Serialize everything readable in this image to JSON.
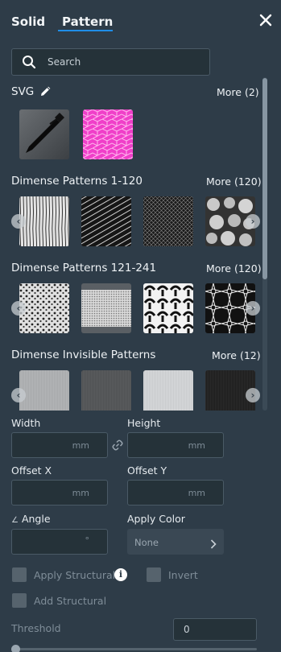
{
  "tabs": [
    {
      "label": "Solid",
      "active": false
    },
    {
      "label": "Pattern",
      "active": true
    }
  ],
  "search": {
    "placeholder": "Search",
    "value": ""
  },
  "sections": [
    {
      "title": "SVG",
      "more": "More (2)"
    },
    {
      "title": "Dimense Patterns 1-120",
      "more": "More (120)"
    },
    {
      "title": "Dimense Patterns 121-241",
      "more": "More (120)"
    },
    {
      "title": "Dimense Invisible Patterns",
      "more": "More (12)"
    }
  ],
  "fields": {
    "width": {
      "label": "Width",
      "value": "",
      "unit": "mm"
    },
    "height": {
      "label": "Height",
      "value": "",
      "unit": "mm"
    },
    "offset_x": {
      "label": "Offset X",
      "value": "",
      "unit": "mm"
    },
    "offset_y": {
      "label": "Offset Y",
      "value": "",
      "unit": "mm"
    },
    "angle": {
      "label": "Angle",
      "value": "",
      "unit": "°",
      "prefix": "∠"
    },
    "apply_color": {
      "label": "Apply Color",
      "value": "None"
    }
  },
  "checkboxes": {
    "apply_structural": {
      "label": "Apply Structural",
      "checked": false
    },
    "invert": {
      "label": "Invert",
      "checked": false
    },
    "add_structural": {
      "label": "Add Structural",
      "checked": false
    }
  },
  "threshold": {
    "label": "Threshold",
    "value": "0"
  },
  "colors": {
    "background": "#2e3c48",
    "accent": "#1f8ee8",
    "field_bg": "#253239",
    "pink_pattern": "#f03fc9"
  }
}
